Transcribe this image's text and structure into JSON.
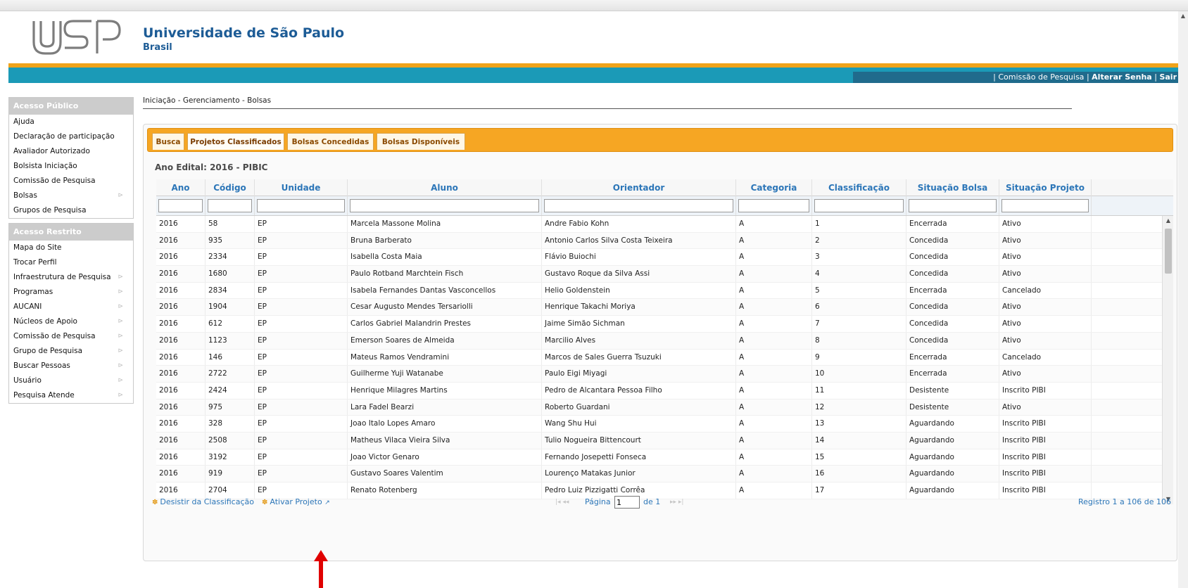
{
  "header": {
    "university": "Universidade de São Paulo",
    "country": "Brasil",
    "logo_text": "USP"
  },
  "top_links": {
    "separator": "|",
    "commission": "Comissão de Pesquisa",
    "change_password": "Alterar Senha",
    "logout": "Sair"
  },
  "sidebar": {
    "public_title": "Acesso Público",
    "public_items": [
      {
        "label": "Ajuda",
        "submenu": false
      },
      {
        "label": "Declaração de participação",
        "submenu": false
      },
      {
        "label": "Avaliador Autorizado",
        "submenu": false
      },
      {
        "label": "Bolsista Iniciação",
        "submenu": false
      },
      {
        "label": "Comissão de Pesquisa",
        "submenu": false
      },
      {
        "label": "Bolsas",
        "submenu": true
      },
      {
        "label": "Grupos de Pesquisa",
        "submenu": false
      }
    ],
    "restricted_title": "Acesso Restrito",
    "restricted_items": [
      {
        "label": "Mapa do Site",
        "submenu": false
      },
      {
        "label": "Trocar Perfil",
        "submenu": false
      },
      {
        "label": "Infraestrutura de Pesquisa",
        "submenu": true
      },
      {
        "label": "Programas",
        "submenu": true
      },
      {
        "label": "AUCANI",
        "submenu": true
      },
      {
        "label": "Núcleos de Apoio",
        "submenu": true
      },
      {
        "label": "Comissão de Pesquisa",
        "submenu": true
      },
      {
        "label": "Grupo de Pesquisa",
        "submenu": true
      },
      {
        "label": "Buscar Pessoas",
        "submenu": true
      },
      {
        "label": "Usuário",
        "submenu": true
      },
      {
        "label": "Pesquisa Atende",
        "submenu": true
      }
    ]
  },
  "breadcrumb": "Iniciação - Gerenciamento - Bolsas",
  "tabs": [
    {
      "label": "Busca",
      "active": false
    },
    {
      "label": "Projetos Classificados",
      "active": true
    },
    {
      "label": "Bolsas Concedidas",
      "active": false
    },
    {
      "label": "Bolsas Disponíveis",
      "active": false
    }
  ],
  "ano_edital": "Ano Edital: 2016 - PIBIC",
  "grid": {
    "columns": [
      "Ano",
      "Código",
      "Unidade",
      "Aluno",
      "Orientador",
      "Categoria",
      "Classificação",
      "Situação Bolsa",
      "Situação Projeto"
    ],
    "rows": [
      [
        "2016",
        "58",
        "EP",
        "Marcela Massone Molina",
        "Andre Fabio Kohn",
        "A",
        "1",
        "Encerrada",
        "Ativo"
      ],
      [
        "2016",
        "935",
        "EP",
        "Bruna Barberato",
        "Antonio Carlos Silva Costa Teixeira",
        "A",
        "2",
        "Concedida",
        "Ativo"
      ],
      [
        "2016",
        "2334",
        "EP",
        "Isabella Costa Maia",
        "Flávio Buiochi",
        "A",
        "3",
        "Concedida",
        "Ativo"
      ],
      [
        "2016",
        "1680",
        "EP",
        "Paulo Rotband Marchtein Fisch",
        "Gustavo Roque da Silva Assi",
        "A",
        "4",
        "Concedida",
        "Ativo"
      ],
      [
        "2016",
        "2834",
        "EP",
        "Isabela Fernandes Dantas Vasconcellos",
        "Helio Goldenstein",
        "A",
        "5",
        "Encerrada",
        "Cancelado"
      ],
      [
        "2016",
        "1904",
        "EP",
        "Cesar Augusto Mendes Tersariolli",
        "Henrique Takachi Moriya",
        "A",
        "6",
        "Concedida",
        "Ativo"
      ],
      [
        "2016",
        "612",
        "EP",
        "Carlos Gabriel Malandrin Prestes",
        "Jaime Simão Sichman",
        "A",
        "7",
        "Concedida",
        "Ativo"
      ],
      [
        "2016",
        "1123",
        "EP",
        "Emerson Soares de Almeida",
        "Marcilio Alves",
        "A",
        "8",
        "Concedida",
        "Ativo"
      ],
      [
        "2016",
        "146",
        "EP",
        "Mateus Ramos Vendramini",
        "Marcos de Sales Guerra Tsuzuki",
        "A",
        "9",
        "Encerrada",
        "Cancelado"
      ],
      [
        "2016",
        "2722",
        "EP",
        "Guilherme Yuji Watanabe",
        "Paulo Eigi Miyagi",
        "A",
        "10",
        "Encerrada",
        "Ativo"
      ],
      [
        "2016",
        "2424",
        "EP",
        "Henrique Milagres Martins",
        "Pedro de Alcantara Pessoa Filho",
        "A",
        "11",
        "Desistente",
        "Inscrito PIBI"
      ],
      [
        "2016",
        "975",
        "EP",
        "Lara Fadel Bearzi",
        "Roberto Guardani",
        "A",
        "12",
        "Desistente",
        "Ativo"
      ],
      [
        "2016",
        "328",
        "EP",
        "Joao Italo Lopes Amaro",
        "Wang Shu Hui",
        "A",
        "13",
        "Aguardando",
        "Inscrito PIBI"
      ],
      [
        "2016",
        "2508",
        "EP",
        "Matheus Vilaca Vieira Silva",
        "Tulio Nogueira Bittencourt",
        "A",
        "14",
        "Aguardando",
        "Inscrito PIBI"
      ],
      [
        "2016",
        "3192",
        "EP",
        "Joao Victor Genaro",
        "Fernando Josepetti Fonseca",
        "A",
        "15",
        "Aguardando",
        "Inscrito PIBI"
      ],
      [
        "2016",
        "919",
        "EP",
        "Gustavo Soares Valentim",
        "Lourenço Matakas Junior",
        "A",
        "16",
        "Aguardando",
        "Inscrito PIBI"
      ],
      [
        "2016",
        "2704",
        "EP",
        "Renato Rotenberg",
        "Pedro Luiz Pizzigatti Corrêa",
        "A",
        "17",
        "Aguardando",
        "Inscrito PIBI"
      ]
    ]
  },
  "pager": {
    "action_withdraw": "Desistir da Classificação",
    "action_activate": "Ativar Projeto",
    "page_label": "Página",
    "page_value": "1",
    "of_label": "de 1",
    "records": "Registro 1 a 106 de 106"
  },
  "colors": {
    "accent_orange": "#f6a623",
    "band_teal": "#1b9ab7",
    "link_blue": "#2c76b8",
    "arrow_red": "#e00000"
  }
}
